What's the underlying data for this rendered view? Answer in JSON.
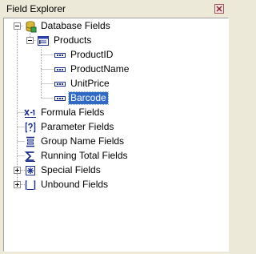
{
  "window": {
    "title": "Field Explorer",
    "close_icon": "close-icon"
  },
  "tree": {
    "nodes": [
      {
        "label": "Database Fields",
        "icon": "database-icon",
        "expanded": true
      },
      {
        "label": "Products",
        "icon": "table-icon",
        "expanded": true
      },
      {
        "label": "ProductID",
        "icon": "field-icon"
      },
      {
        "label": "ProductName",
        "icon": "field-icon"
      },
      {
        "label": "UnitPrice",
        "icon": "field-icon"
      },
      {
        "label": "Barcode",
        "icon": "field-icon",
        "selected": true
      },
      {
        "label": "Formula Fields",
        "icon": "formula-icon"
      },
      {
        "label": "Parameter Fields",
        "icon": "parameter-icon"
      },
      {
        "label": "Group Name Fields",
        "icon": "group-name-icon"
      },
      {
        "label": "Running Total Fields",
        "icon": "running-total-icon"
      },
      {
        "label": "Special Fields",
        "icon": "special-fields-icon",
        "expanded": false
      },
      {
        "label": "Unbound Fields",
        "icon": "unbound-fields-icon",
        "expanded": false
      }
    ]
  },
  "colors": {
    "selection": "#316ac5",
    "panel_bg": "#ece9d8",
    "tree_bg": "#ffffff"
  }
}
